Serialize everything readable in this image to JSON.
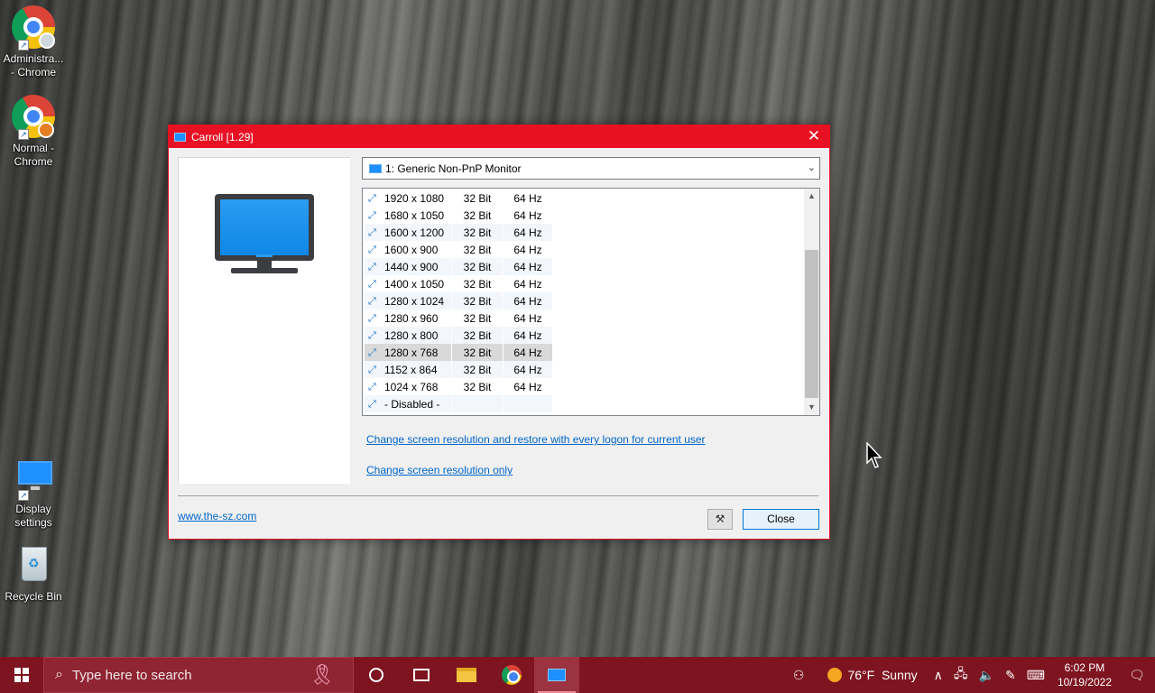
{
  "desktop": {
    "icons": [
      {
        "label": "Administra... - Chrome"
      },
      {
        "label": "Normal - Chrome"
      },
      {
        "label": "Display settings"
      },
      {
        "label": "Recycle Bin"
      }
    ]
  },
  "window": {
    "title": "Carroll [1.29]",
    "close_glyph": "✕",
    "monitor_select": {
      "value": "1: Generic Non-PnP Monitor"
    },
    "resolutions": [
      {
        "res": "1920 x 1080",
        "bits": "32 Bit",
        "hz": "64 Hz"
      },
      {
        "res": "1680 x 1050",
        "bits": "32 Bit",
        "hz": "64 Hz"
      },
      {
        "res": "1600 x 1200",
        "bits": "32 Bit",
        "hz": "64 Hz"
      },
      {
        "res": "1600 x 900",
        "bits": "32 Bit",
        "hz": "64 Hz"
      },
      {
        "res": "1440 x 900",
        "bits": "32 Bit",
        "hz": "64 Hz"
      },
      {
        "res": "1400 x 1050",
        "bits": "32 Bit",
        "hz": "64 Hz"
      },
      {
        "res": "1280 x 1024",
        "bits": "32 Bit",
        "hz": "64 Hz"
      },
      {
        "res": "1280 x 960",
        "bits": "32 Bit",
        "hz": "64 Hz"
      },
      {
        "res": "1280 x 800",
        "bits": "32 Bit",
        "hz": "64 Hz"
      },
      {
        "res": "1280 x 768",
        "bits": "32 Bit",
        "hz": "64 Hz"
      },
      {
        "res": "1152 x 864",
        "bits": "32 Bit",
        "hz": "64 Hz"
      },
      {
        "res": "1024 x 768",
        "bits": "32 Bit",
        "hz": "64 Hz"
      },
      {
        "res": "- Disabled -",
        "bits": "",
        "hz": ""
      }
    ],
    "links": {
      "restore_logon": "Change screen resolution and restore with every logon for current user",
      "change_only": "Change screen resolution only",
      "website": "www.the-sz.com"
    },
    "buttons": {
      "close": "Close"
    }
  },
  "taskbar": {
    "search_placeholder": "Type here to search",
    "weather": {
      "temp": "76°F",
      "condition": "Sunny"
    },
    "clock": {
      "time": "6:02 PM",
      "date": "10/19/2022"
    }
  }
}
